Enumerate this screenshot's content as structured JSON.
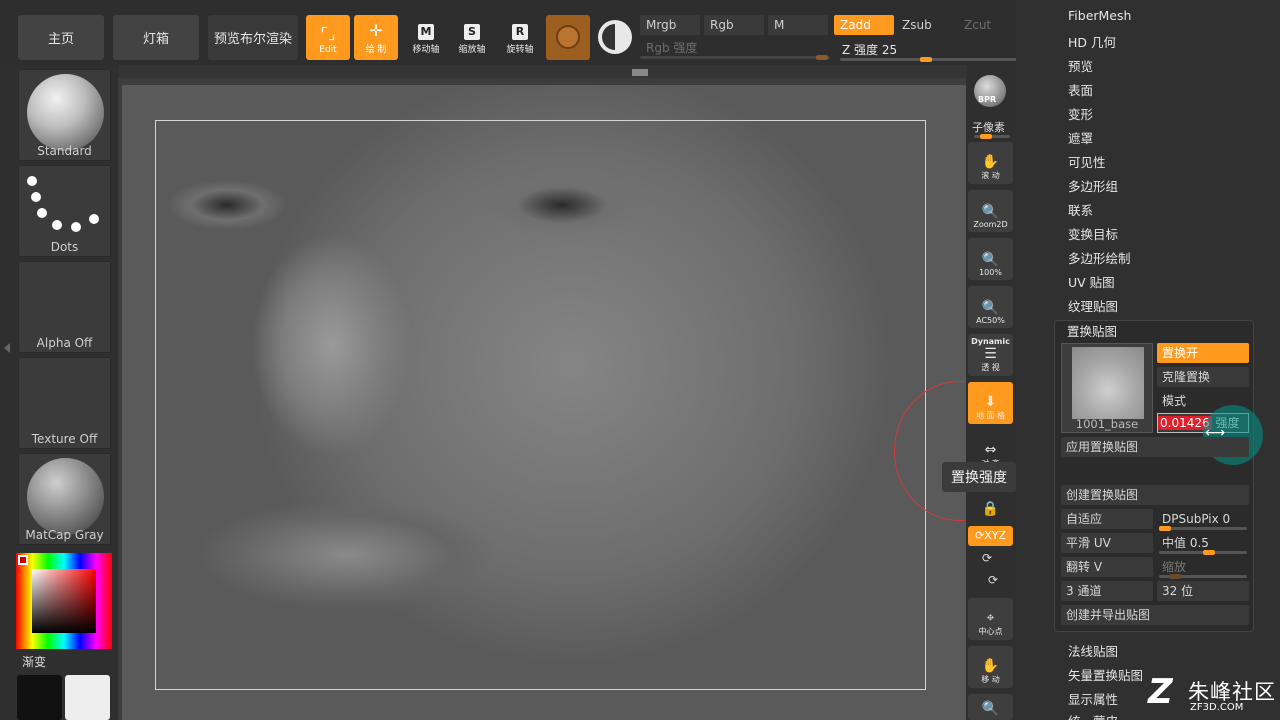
{
  "colors": {
    "accent": "#ff9a1f",
    "panel": "#303030",
    "alert": "#e0202d",
    "brush_ring": "#d23b3b"
  },
  "top_bar": {
    "tabs": [
      {
        "label": "主页"
      },
      {
        "label": "灯箱"
      },
      {
        "label": "预览布尔渲染"
      }
    ],
    "tools": [
      {
        "label": "Edit",
        "icon": "edit-icon",
        "active": true
      },
      {
        "label": "绘 制",
        "icon": "draw-icon",
        "active": true
      },
      {
        "label": "移动轴",
        "icon": "move-icon",
        "key": "M",
        "active": false
      },
      {
        "label": "缩放轴",
        "icon": "scale-icon",
        "key": "S",
        "active": false
      },
      {
        "label": "旋转轴",
        "icon": "rotate-icon",
        "key": "R",
        "active": false
      }
    ],
    "rgb_modes": {
      "mrgb": "Mrgb",
      "rgb": "Rgb",
      "m": "M",
      "rgb_intensity": "Rgb 强度"
    },
    "z_modes": {
      "zadd": "Zadd",
      "zsub": "Zsub",
      "zcut": "Zcut"
    },
    "z_intensity": {
      "label": "Z 强度",
      "value": "25"
    }
  },
  "left_shelf": {
    "brush": "Standard",
    "stroke": "Dots",
    "alpha": "Alpha Off",
    "texture": "Texture Off",
    "material": "MatCap Gray",
    "gradient_label": "渐变"
  },
  "right_strip": {
    "bpr": "BPR",
    "subpixel": "子像素",
    "buttons": [
      {
        "label": "滚 动",
        "icon": "scroll-icon"
      },
      {
        "label": "Zoom2D",
        "icon": "zoom2d-icon"
      },
      {
        "label": "100%",
        "icon": "zoom-100-icon"
      },
      {
        "label": "AC50%",
        "icon": "zoom-ac50-icon"
      },
      {
        "label": "透 视",
        "icon": "perspective-icon",
        "top_label": "Dynamic"
      },
      {
        "label": "地 面 格",
        "icon": "floor-grid-icon",
        "active": true
      },
      {
        "label": "对 齐",
        "icon": "align-icon"
      },
      {
        "label": "锁 定",
        "icon": "lock-icon"
      },
      {
        "label": "XYZ",
        "icon": "xyz-rotate-icon",
        "active": true
      },
      {
        "label": "中心点",
        "icon": "center-point-icon"
      },
      {
        "label": "移 动",
        "icon": "move-view-icon"
      }
    ],
    "tooltip": "置换强度"
  },
  "palette": {
    "menu_top": [
      "FiberMesh",
      "HD 几何",
      "预览",
      "表面",
      "变形",
      "遮罩",
      "可见性",
      "多边形组",
      "联系",
      "变换目标",
      "多边形绘制",
      "UV 贴图",
      "纹理贴图"
    ],
    "active_section": "置换贴图",
    "displacement": {
      "thumbnail_label": "1001_base",
      "displacement_on": "置换开",
      "clone_displacement": "克隆置换",
      "mode": "模式",
      "intensity_value": "0.01426",
      "intensity_label": "强度",
      "apply": "应用置换贴图",
      "create": "创建置换贴图",
      "adaptive": "自适应",
      "dpsubpix": "DPSubPix 0",
      "smooth_uv": "平滑 UV",
      "mid_value": "中值 0.5",
      "flip_v": "翻转 V",
      "scale": "缩放",
      "channels": "3 通道",
      "bits": "32 位",
      "create_export": "创建并导出贴图"
    },
    "menu_bottom": [
      "法线贴图",
      "矢量置换贴图",
      "显示属性",
      "统一蒙皮"
    ]
  },
  "watermark": {
    "name": "朱峰社区",
    "url": "ZF3D.COM",
    "logo": "Z"
  }
}
